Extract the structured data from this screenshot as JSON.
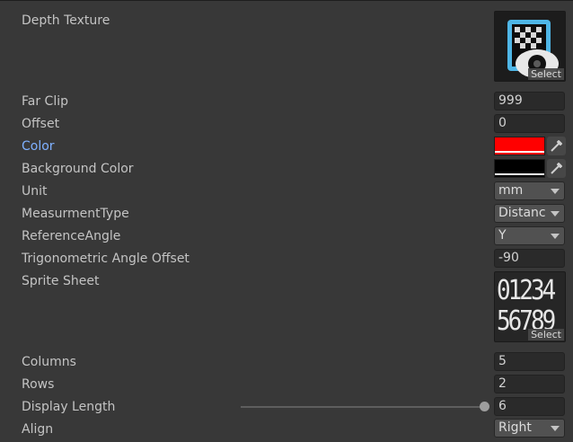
{
  "fields": {
    "depth_texture": {
      "label": "Depth Texture",
      "select_label": "Select"
    },
    "far_clip": {
      "label": "Far Clip",
      "value": "999"
    },
    "offset": {
      "label": "Offset",
      "value": "0"
    },
    "color": {
      "label": "Color",
      "value": "#ff0000"
    },
    "background_color": {
      "label": "Background Color",
      "value": "#000000"
    },
    "unit": {
      "label": "Unit",
      "value": "mm"
    },
    "measurement_type": {
      "label": "MeasurmentType",
      "value": "Distanc"
    },
    "reference_angle": {
      "label": "ReferenceAngle",
      "value": "Y"
    },
    "trig_angle_offset": {
      "label": "Trigonometric Angle Offset",
      "value": "-90"
    },
    "sprite_sheet": {
      "label": "Sprite Sheet",
      "select_label": "Select",
      "digits_row1": "01234",
      "digits_row2": "56789"
    },
    "columns": {
      "label": "Columns",
      "value": "5"
    },
    "rows": {
      "label": "Rows",
      "value": "2"
    },
    "display_length": {
      "label": "Display Length",
      "value": "6",
      "slider_fraction": 1.0
    },
    "align": {
      "label": "Align",
      "value": "Right"
    }
  },
  "colors": {
    "background": "#383838",
    "highlight_label": "#7fb1ff",
    "field_bg": "#2a2a2a",
    "dropdown_bg": "#515151",
    "texture_blue": "#4fb6e6"
  }
}
